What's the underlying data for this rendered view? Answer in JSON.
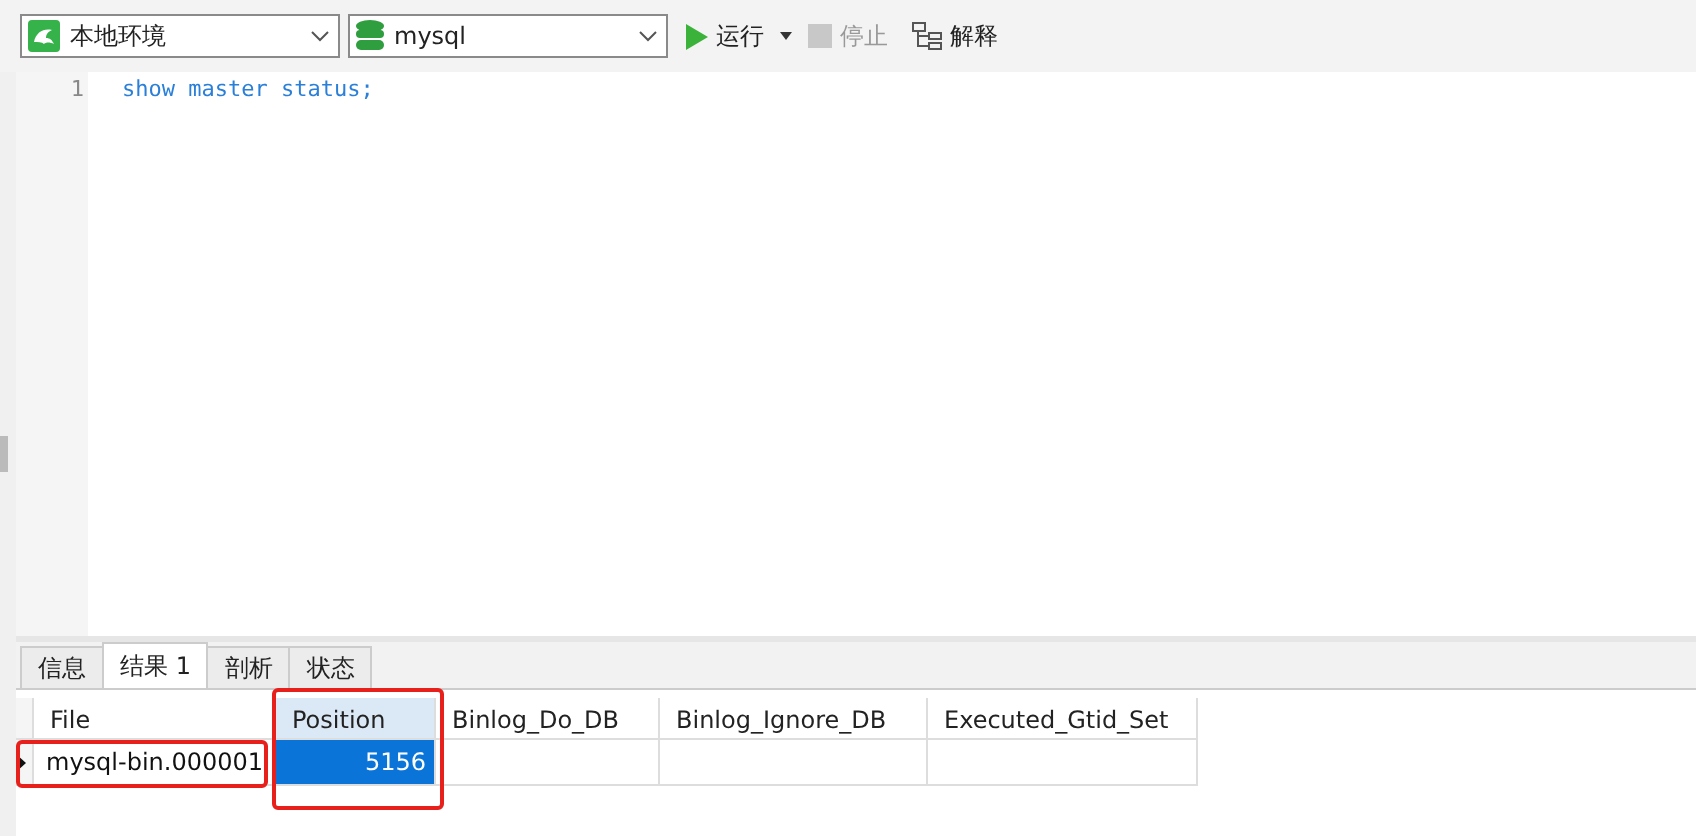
{
  "toolbar": {
    "connection": "本地环境",
    "database": "mysql",
    "buttons": [
      {
        "kind": "run",
        "label": "运行",
        "disabled": false
      },
      {
        "kind": "stop",
        "label": "停止",
        "disabled": true
      },
      {
        "kind": "explain",
        "label": "解释",
        "disabled": false
      }
    ]
  },
  "editor": {
    "lines": [
      {
        "number": "1",
        "code": "show master status;"
      }
    ]
  },
  "result_tabs": [
    {
      "label": "信息",
      "selected": false
    },
    {
      "label": "结果 1",
      "selected": true
    },
    {
      "label": "剖析",
      "selected": false
    },
    {
      "label": "状态",
      "selected": false
    }
  ],
  "table": {
    "columns": [
      {
        "label": "File",
        "selected": false,
        "outlined": false
      },
      {
        "label": "Position",
        "selected": true,
        "outlined": true
      },
      {
        "label": "Binlog_Do_DB",
        "selected": false,
        "outlined": false
      },
      {
        "label": "Binlog_Ignore_DB",
        "selected": false,
        "outlined": false
      },
      {
        "label": "Executed_Gtid_Set",
        "selected": false,
        "outlined": false
      }
    ],
    "rows": [
      {
        "current": true,
        "cells": [
          {
            "value": "mysql-bin.000001",
            "selected": false,
            "outlined": true
          },
          {
            "value": "5156",
            "selected": true,
            "outlined": false
          },
          {
            "selected": false,
            "outlined": false
          },
          {
            "selected": false,
            "outlined": false
          },
          {
            "selected": false,
            "outlined": false
          }
        ]
      }
    ]
  }
}
